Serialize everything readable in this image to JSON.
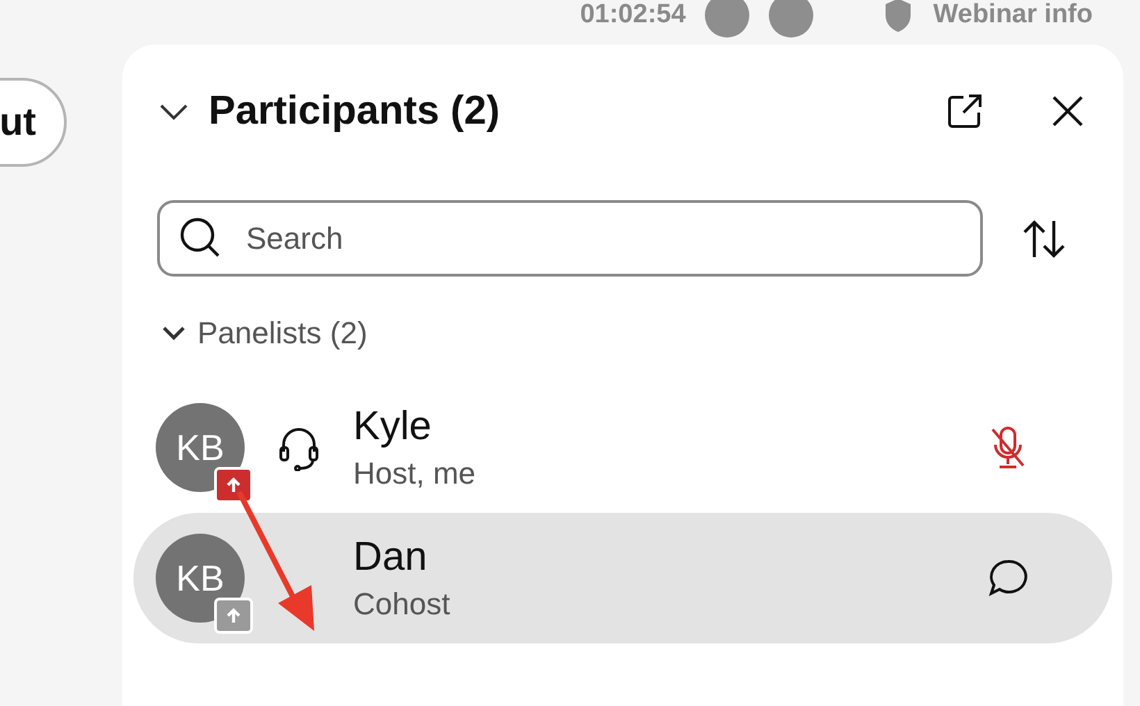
{
  "top_bar": {
    "timer": "01:02:54",
    "info_link": "Webinar info"
  },
  "left_button": {
    "label": "ut"
  },
  "panel": {
    "title": "Participants (2)",
    "expanded": true,
    "search": {
      "placeholder": "Search"
    },
    "groups": [
      {
        "label": "Panelists (2)",
        "expanded": true,
        "participants": [
          {
            "initials": "KB",
            "name": "Kyle",
            "role": "Host, me",
            "selected": false,
            "color": "#cc2e2e",
            "headset": true,
            "kind": "muted-mic"
          },
          {
            "initials": "KB",
            "name": "Dan",
            "role": "Cohost",
            "selected": true,
            "color": "#9a9a9a",
            "headset": false,
            "kind": "chat"
          }
        ]
      }
    ]
  }
}
